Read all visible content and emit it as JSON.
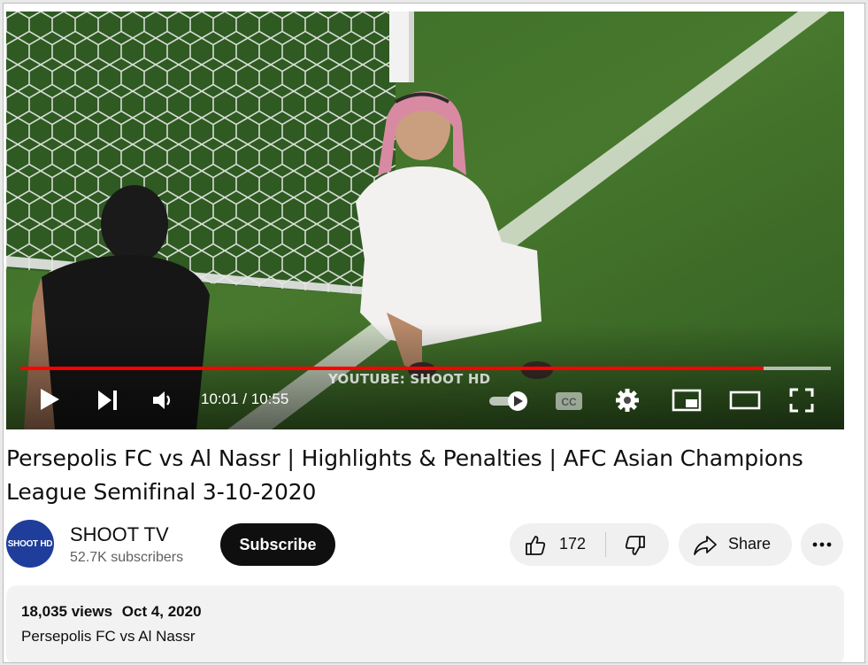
{
  "video": {
    "watermark": "YOUTUBE: SHOOT HD",
    "time_current": "10:01",
    "time_total": "10:55",
    "progress": 0.917,
    "colors": {
      "progress": "#ff0000",
      "autoplay_toggle": "on"
    }
  },
  "controls": {
    "play_icon": "play-icon",
    "next_icon": "next-icon",
    "volume_icon": "volume-icon",
    "autoplay_icon": "autoplay-toggle-icon",
    "captions_icon": "captions-icon",
    "settings_icon": "gear-icon",
    "miniplayer_icon": "miniplayer-icon",
    "theater_icon": "theater-icon",
    "fullscreen_icon": "fullscreen-icon"
  },
  "title": "Persepolis FC vs Al Nassr | Highlights & Penalties | AFC Asian Champions League Semifinal 3-10-2020",
  "channel": {
    "avatar_text": "SHOOT HD",
    "name": "SHOOT TV",
    "subscribers": "52.7K subscribers",
    "subscribe_label": "Subscribe"
  },
  "actions": {
    "like_count": "172",
    "share_label": "Share"
  },
  "description": {
    "views": "18,035 views",
    "date": "Oct 4, 2020",
    "text": "Persepolis FC vs Al Nassr"
  }
}
